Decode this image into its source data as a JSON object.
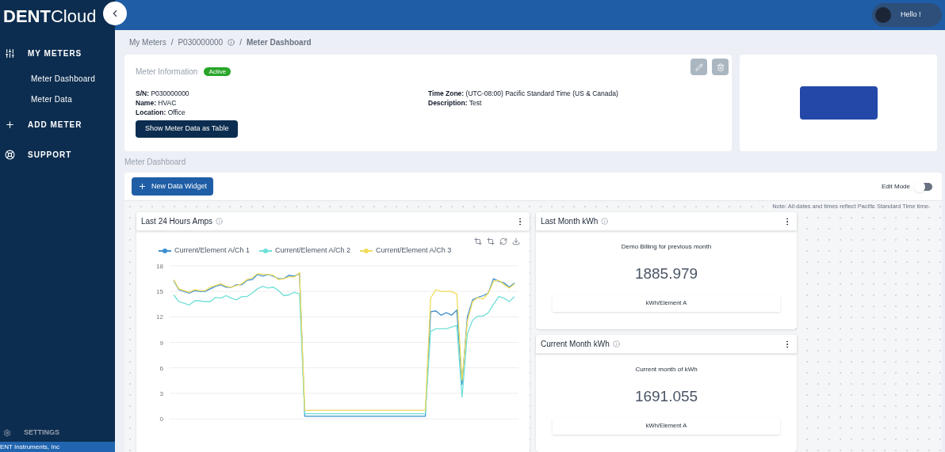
{
  "brand": {
    "bold": "DENT",
    "light": "Cloud"
  },
  "header": {
    "greeting": "Hello !"
  },
  "sidebar": {
    "items": [
      {
        "kind": "sliders",
        "label": "MY METERS",
        "children": [
          {
            "label": "Meter Dashboard"
          },
          {
            "label": "Meter Data"
          }
        ]
      },
      {
        "kind": "plus",
        "label": "ADD METER"
      },
      {
        "kind": "support",
        "label": "SUPPORT"
      }
    ],
    "settings": "SETTINGS",
    "footer": "ENT Instruments, Inc"
  },
  "breadcrumb": [
    "My Meters",
    "P030000000",
    "Meter Dashboard"
  ],
  "breadcrumb_separator": "/",
  "meter_info": {
    "title": "Meter Information",
    "status": "Active",
    "left": [
      {
        "label": "S/N:",
        "value": "P030000000"
      },
      {
        "label": "Name:",
        "value": "HVAC"
      },
      {
        "label": "Location:",
        "value": "Office"
      }
    ],
    "right": [
      {
        "label": "Time Zone:",
        "value": "(UTC-08:00) Pacific Standard Time (US & Canada)"
      },
      {
        "label": "Description:",
        "value": "Test"
      }
    ],
    "button": "Show Meter Data as Table"
  },
  "dashboard": {
    "title": "Meter Dashboard",
    "new_widget": "New Data Widget",
    "edit_mode": {
      "label": "Edit Mode",
      "on": false
    },
    "note": "Note: All dates and times reflect Pacific Standard Time time."
  },
  "chart_widget": {
    "title": "Last 24 Hours Amps",
    "chart_data": {
      "type": "line",
      "grid": true,
      "legend": true,
      "ylim": [
        0,
        18
      ],
      "yticks": [
        0,
        3,
        6,
        9,
        12,
        15,
        18
      ],
      "series": [
        {
          "name": "Current/Element A/Ch 1",
          "color": "#3b8fd0",
          "values": [
            16.3,
            15.2,
            15.0,
            14.8,
            15.1,
            15.0,
            15.0,
            15.3,
            15.6,
            15.8,
            15.5,
            15.5,
            15.8,
            15.8,
            16.3,
            16.4,
            17.0,
            16.8,
            17.0,
            16.8,
            16.5,
            16.5,
            16.9,
            16.8,
            17.1,
            0.3,
            0.3,
            0.3,
            0.3,
            0.3,
            0.3,
            0.3,
            0.3,
            0.3,
            0.3,
            0.3,
            0.3,
            0.3,
            0.3,
            0.3,
            0.3,
            0.3,
            0.3,
            0.3,
            0.3,
            0.3,
            0.3,
            0.3,
            0.3,
            12.6,
            12.7,
            12.2,
            12.5,
            12.2,
            12.8,
            4.0,
            12.0,
            14.0,
            14.3,
            14.5,
            14.8,
            16.5,
            16.2,
            16.0,
            15.5,
            16.0
          ]
        },
        {
          "name": "Current/Element A/Ch 2",
          "color": "#6fe0d8",
          "values": [
            14.6,
            13.8,
            13.6,
            13.4,
            13.9,
            13.9,
            13.8,
            13.8,
            14.3,
            14.2,
            14.5,
            14.2,
            14.0,
            14.4,
            14.4,
            14.8,
            15.3,
            15.6,
            15.4,
            15.5,
            15.1,
            14.5,
            14.6,
            14.9,
            14.7,
            0.6,
            0.6,
            0.6,
            0.6,
            0.6,
            0.6,
            0.6,
            0.6,
            0.6,
            0.6,
            0.6,
            0.6,
            0.6,
            0.6,
            0.6,
            0.6,
            0.6,
            0.6,
            0.6,
            0.6,
            0.6,
            0.6,
            0.6,
            0.6,
            10.3,
            10.6,
            10.6,
            10.6,
            10.8,
            11.0,
            2.5,
            10.0,
            11.6,
            12.1,
            12.1,
            12.5,
            13.5,
            14.4,
            14.2,
            13.8,
            14.4
          ]
        },
        {
          "name": "Current/Element A/Ch 3",
          "color": "#f0dc5a",
          "values": [
            16.4,
            15.3,
            15.1,
            14.9,
            15.2,
            15.1,
            15.1,
            15.5,
            15.7,
            15.9,
            15.6,
            15.5,
            15.7,
            15.9,
            16.4,
            16.6,
            17.1,
            17.0,
            17.0,
            16.9,
            16.4,
            16.5,
            16.7,
            16.7,
            17.2,
            1.0,
            1.0,
            1.0,
            1.0,
            1.0,
            1.0,
            1.0,
            1.0,
            1.0,
            1.0,
            1.0,
            1.0,
            1.0,
            1.0,
            1.0,
            1.0,
            1.0,
            1.0,
            1.0,
            1.0,
            1.0,
            1.0,
            1.0,
            1.0,
            14.2,
            15.2,
            15.0,
            15.0,
            15.0,
            14.7,
            4.5,
            11.5,
            13.8,
            14.3,
            14.1,
            14.8,
            16.2,
            16.3,
            15.8,
            15.4,
            15.9
          ]
        }
      ]
    }
  },
  "value_widgets": [
    {
      "title": "Last Month kWh",
      "caption": "Demo Billing for previous month",
      "value": "1885.979",
      "channel": "kWh/Element A"
    },
    {
      "title": "Current Month kWh",
      "caption": "Current month of kWh",
      "value": "1691.055",
      "channel": "kWh/Element A"
    }
  ]
}
